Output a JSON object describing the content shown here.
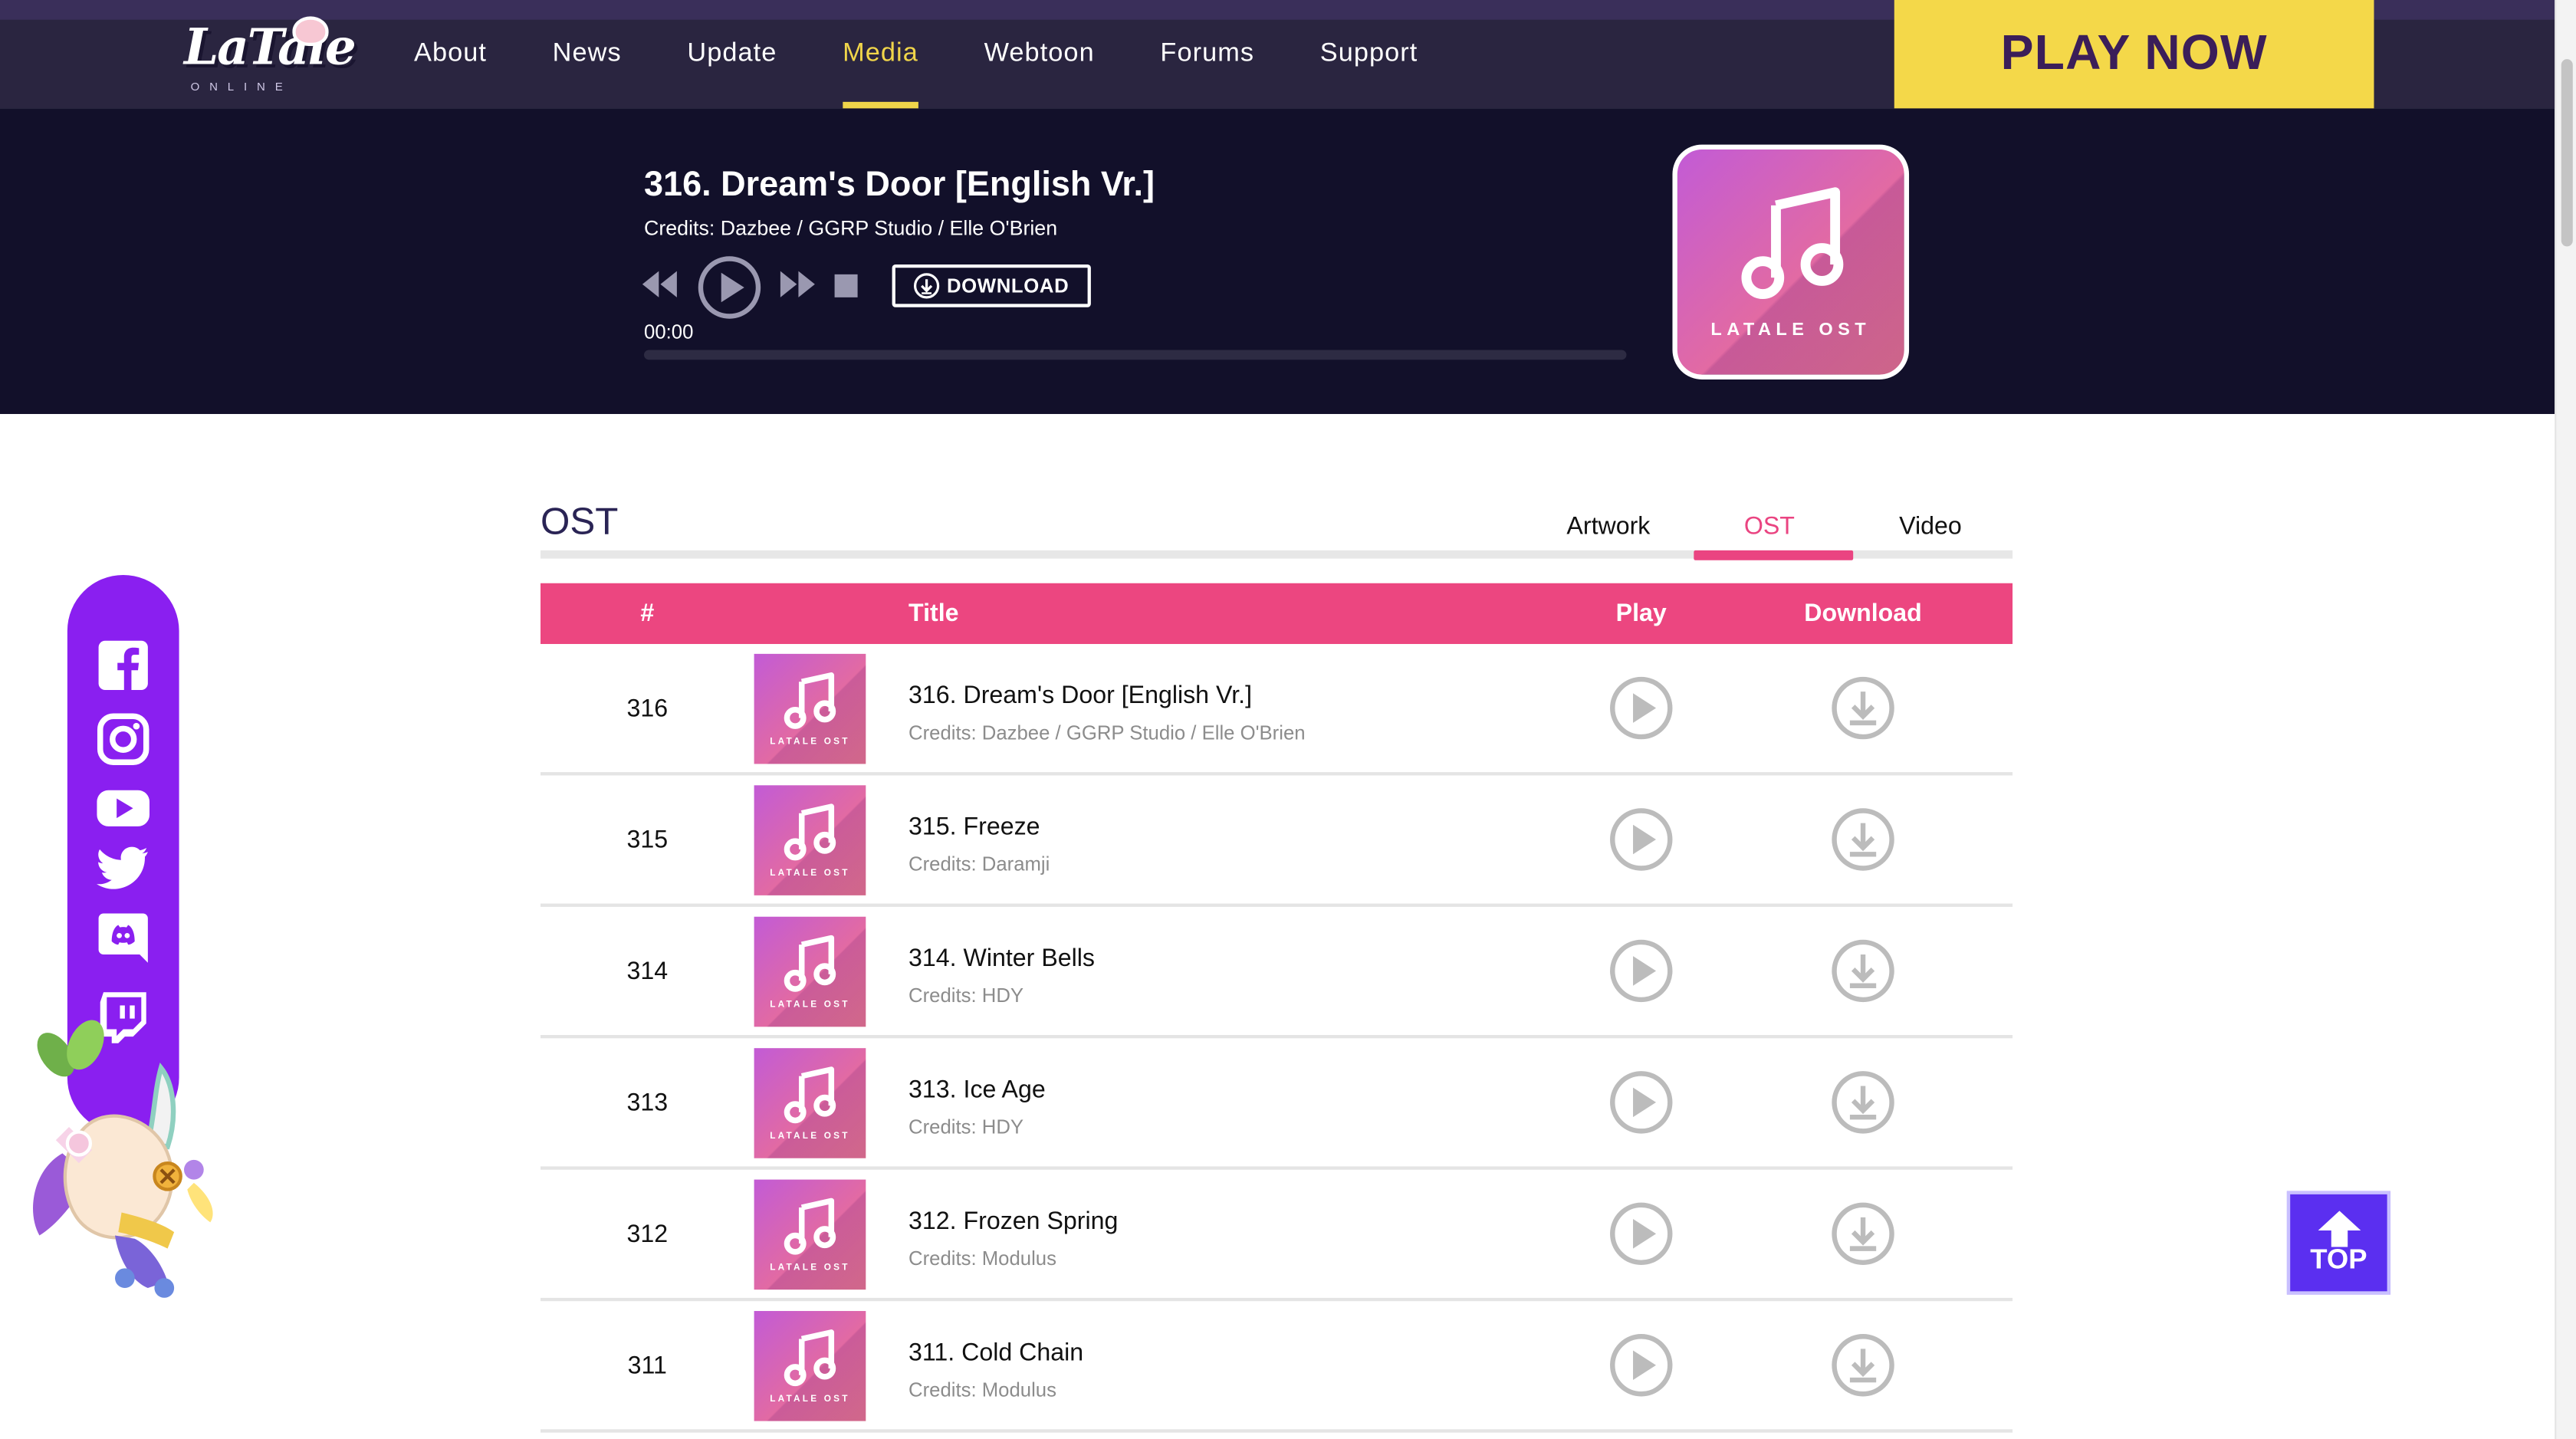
{
  "nav": {
    "logo_text": "LaTale",
    "logo_sub": "ONLINE",
    "items": [
      {
        "label": "About"
      },
      {
        "label": "News"
      },
      {
        "label": "Update"
      },
      {
        "label": "Media",
        "active": true
      },
      {
        "label": "Webtoon"
      },
      {
        "label": "Forums"
      },
      {
        "label": "Support"
      }
    ],
    "play_now": "PLAY NOW"
  },
  "player": {
    "title": "316. Dream's Door [English Vr.]",
    "credits": "Credits: Dazbee / GGRP Studio / Elle O'Brien",
    "download_label": "DOWNLOAD",
    "time": "00:00",
    "progress": 0,
    "cover_caption": "LATALE OST"
  },
  "section": {
    "title": "OST",
    "tabs": [
      {
        "label": "Artwork"
      },
      {
        "label": "OST",
        "active": true
      },
      {
        "label": "Video"
      }
    ]
  },
  "table": {
    "headers": {
      "num": "#",
      "title": "Title",
      "play": "Play",
      "download": "Download"
    },
    "cover_caption": "LATALE OST",
    "rows": [
      {
        "num": "316",
        "title": "316. Dream's Door [English Vr.]",
        "credits": "Credits: Dazbee / GGRP Studio / Elle O'Brien"
      },
      {
        "num": "315",
        "title": "315. Freeze",
        "credits": "Credits: Daramji"
      },
      {
        "num": "314",
        "title": "314. Winter Bells",
        "credits": "Credits: HDY"
      },
      {
        "num": "313",
        "title": "313. Ice Age",
        "credits": "Credits: HDY"
      },
      {
        "num": "312",
        "title": "312. Frozen Spring",
        "credits": "Credits: Modulus"
      },
      {
        "num": "311",
        "title": "311. Cold Chain",
        "credits": "Credits: Modulus"
      }
    ]
  },
  "social": [
    "facebook-icon",
    "instagram-icon",
    "youtube-icon",
    "twitter-icon",
    "discord-icon",
    "twitch-icon"
  ],
  "top_button": {
    "label": "TOP"
  },
  "colors": {
    "nav_bg": "#2a2540",
    "accent_yellow": "#f4d849",
    "hero_bg": "#12102a",
    "pink": "#ec4680",
    "social_purple": "#8a1ff0",
    "top_blue": "#5b2ff0"
  }
}
